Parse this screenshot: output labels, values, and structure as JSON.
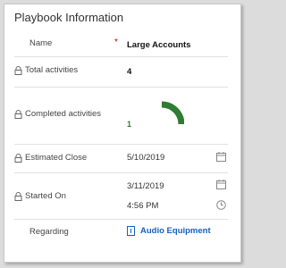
{
  "section": {
    "title": "Playbook Information"
  },
  "fields": {
    "name": {
      "label": "Name",
      "required_marker": "*",
      "value": "Large Accounts"
    },
    "total_activities": {
      "label": "Total activities",
      "value": "4"
    },
    "completed_activities": {
      "label": "Completed activities",
      "value": "1",
      "progress_fraction": 0.25
    },
    "estimated_close": {
      "label": "Estimated Close",
      "value": "5/10/2019"
    },
    "started_on": {
      "label": "Started On",
      "date": "3/11/2019",
      "time": "4:56 PM"
    },
    "regarding": {
      "label": "Regarding",
      "value": "Audio Equipment"
    }
  },
  "icons": {
    "lock": "lock-icon",
    "calendar": "calendar-icon",
    "clock": "clock-icon",
    "record": "record-icon"
  },
  "colors": {
    "gauge": "#2e7d32",
    "link": "#1560bd",
    "required": "#cc0000"
  }
}
